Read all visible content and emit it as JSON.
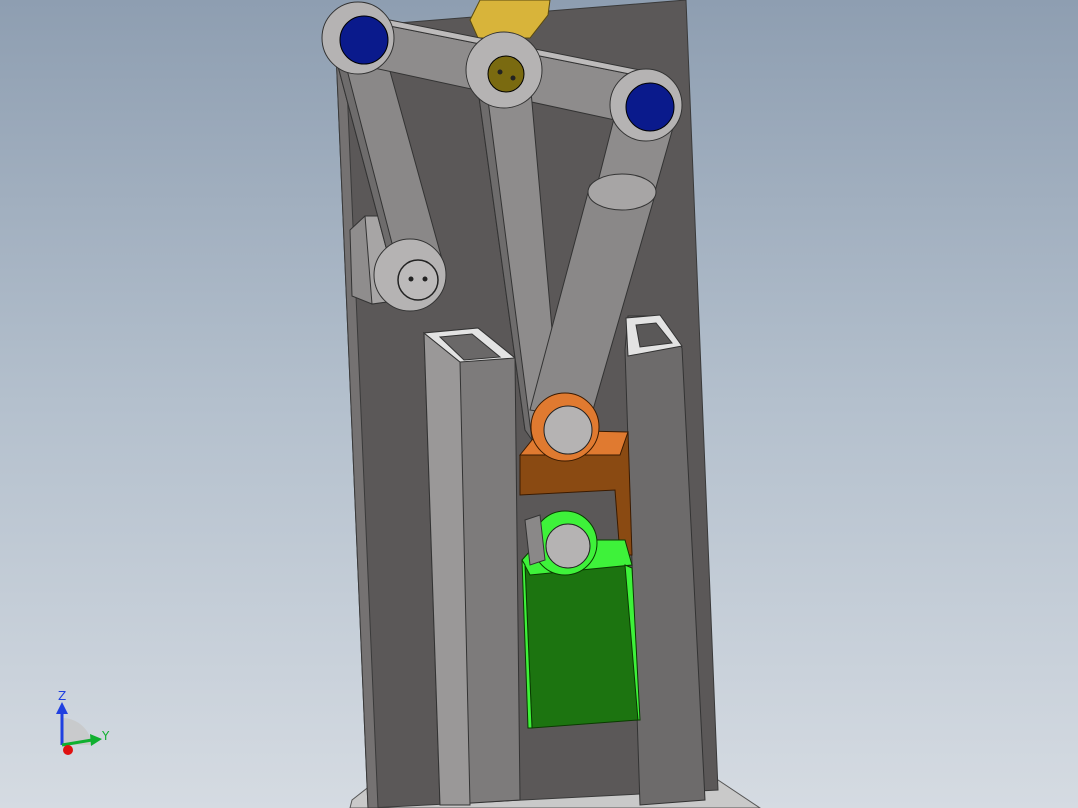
{
  "triad": {
    "z_label": "Z",
    "y_label": "Y",
    "x_color": "#e01010",
    "y_color": "#10b030",
    "z_color": "#2040e0"
  },
  "colors": {
    "background_top": "#8e9eb1",
    "background_bottom": "#d5dbe2",
    "frame": "#5b5858",
    "link": "#8a8888",
    "link_side": "#6e6c6c",
    "pin_blue": "#0a1a8c",
    "pin_gold": "#7a6a10",
    "block_orange": "#8a4a12",
    "block_orange_light": "#e07a30",
    "block_green": "#1c7410",
    "block_green_light": "#3ef23a"
  }
}
